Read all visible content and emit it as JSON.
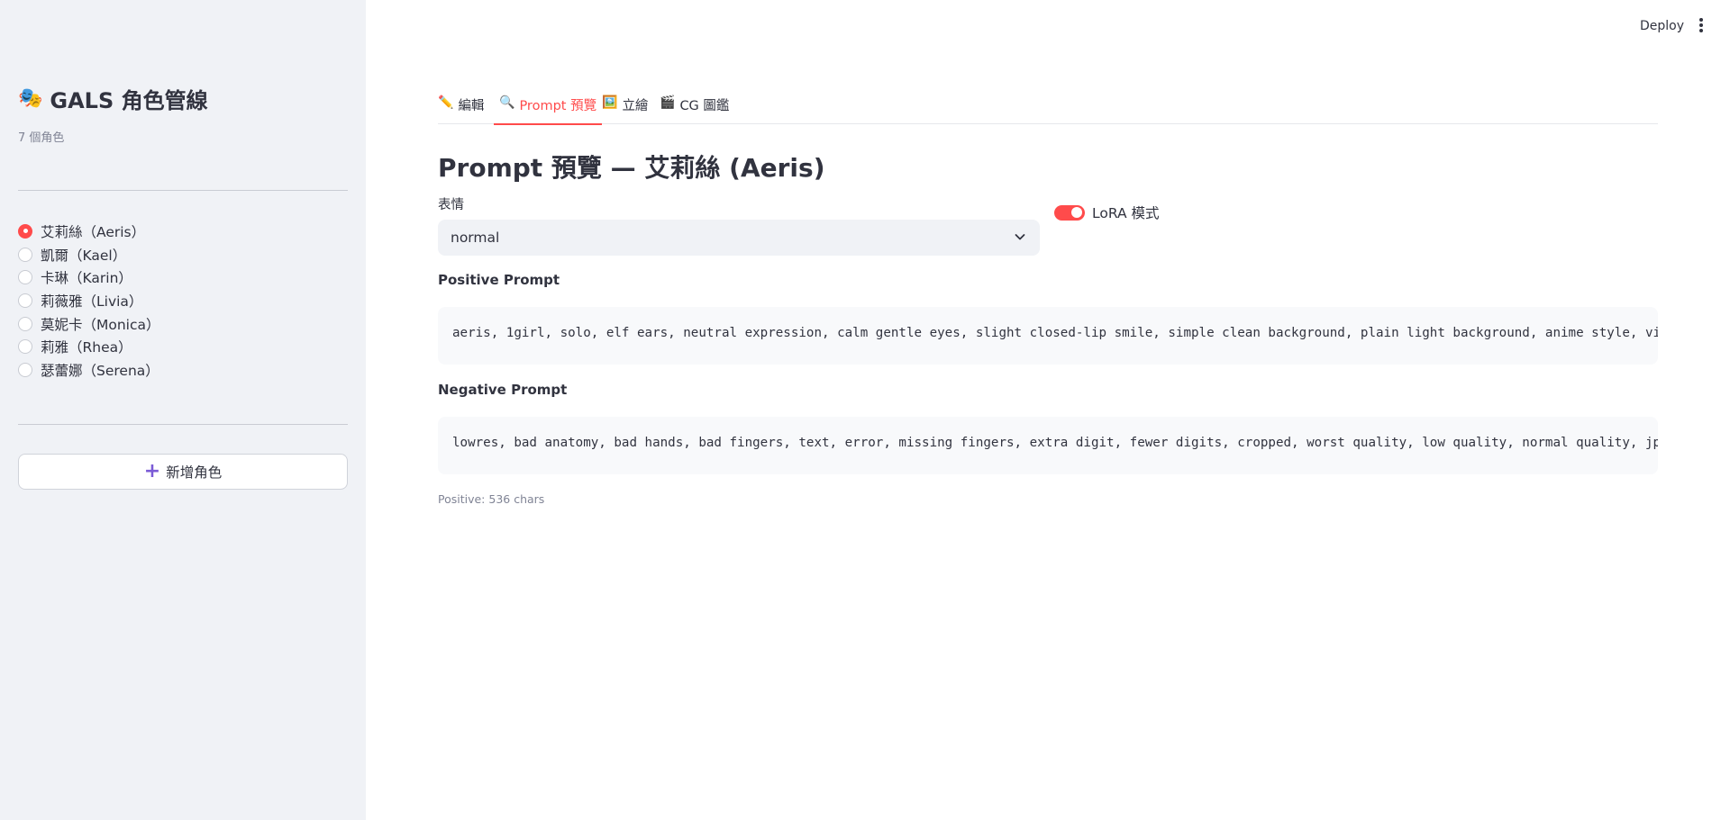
{
  "sidebar": {
    "title": "GALS 角色管線",
    "count": "7 個角色",
    "characters": [
      {
        "label": "艾莉絲（Aeris）",
        "selected": true
      },
      {
        "label": "凱爾（Kael）",
        "selected": false
      },
      {
        "label": "卡琳（Karin）",
        "selected": false
      },
      {
        "label": "莉薇雅（Livia）",
        "selected": false
      },
      {
        "label": "莫妮卡（Monica）",
        "selected": false
      },
      {
        "label": "莉雅（Rhea）",
        "selected": false
      },
      {
        "label": "瑟蕾娜（Serena）",
        "selected": false
      }
    ],
    "add_button": "新增角色"
  },
  "header": {
    "deploy": "Deploy"
  },
  "tabs": [
    {
      "label": "編輯",
      "icon": "pencil-icon"
    },
    {
      "label": "Prompt 預覽",
      "icon": "magnifier-icon",
      "active": true
    },
    {
      "label": "立繪",
      "icon": "picture-icon"
    },
    {
      "label": "CG 圖鑑",
      "icon": "clapper-icon"
    }
  ],
  "main": {
    "title": "Prompt 預覽 — 艾莉絲 (Aeris)",
    "expression_label": "表情",
    "expression_value": "normal",
    "lora_label": "LoRA 模式",
    "lora_enabled": true,
    "positive_label": "Positive Prompt",
    "positive_text": "aeris, 1girl, solo, elf ears, neutral expression, calm gentle eyes, slight closed-lip smile, simple clean background, plain light background, anime style, visu",
    "negative_label": "Negative Prompt",
    "negative_text": "lowres, bad anatomy, bad hands, bad fingers, text, error, missing fingers, extra digit, fewer digits, cropped, worst quality, low quality, normal quality, jpeg",
    "caption": "Positive: 536 chars"
  },
  "colors": {
    "accent": "#ff4b4b",
    "sidebar_bg": "#f0f2f6",
    "code_bg": "#f8f9fb"
  }
}
